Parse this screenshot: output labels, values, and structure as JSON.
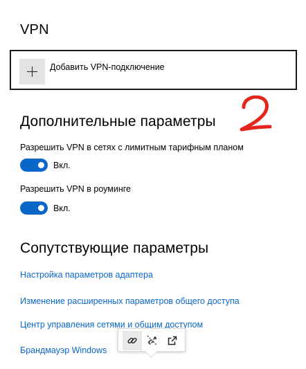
{
  "page": {
    "title": "VPN"
  },
  "add_vpn": {
    "label": "Добавить VPN-подключение",
    "icon": "plus-icon"
  },
  "annotation": {
    "text": "2",
    "color": "#e4251c"
  },
  "advanced": {
    "title": "Дополнительные параметры",
    "metered": {
      "label": "Разрешить VPN в сетях с лимитным тарифным планом",
      "state": "Вкл.",
      "on": true
    },
    "roaming": {
      "label": "Разрешить VPN в роуминге",
      "state": "Вкл.",
      "on": true
    }
  },
  "related": {
    "title": "Сопутствующие параметры",
    "links": [
      "Настройка параметров адаптера",
      "Изменение расширенных параметров общего доступа",
      "Центр управления сетями и общим доступом",
      "Брандмауэр Windows"
    ]
  },
  "link_popover": {
    "icons": [
      "link-icon",
      "unlink-icon",
      "open-external-icon"
    ]
  },
  "colors": {
    "accent": "#0a67c9",
    "toggle_on": "#0a67c9",
    "plus_tile": "#e3e3e3",
    "box_border": "#1a1a1a",
    "annotation": "#e4251c"
  }
}
